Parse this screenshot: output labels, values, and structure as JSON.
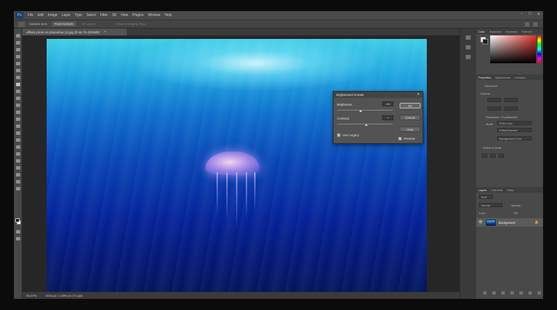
{
  "app": {
    "logo": "Ps"
  },
  "menu": [
    "File",
    "Edit",
    "Image",
    "Layer",
    "Type",
    "Select",
    "Filter",
    "3D",
    "View",
    "Plugins",
    "Window",
    "Help"
  ],
  "window_controls": [
    "–",
    "□",
    "✕"
  ],
  "options_bar": {
    "sample_size_label": "Sample Size:",
    "sample_size_value": "Point Sample",
    "sample_label": "All Layers",
    "ring_label": "Show Sampling Ring"
  },
  "document_tab": {
    "title": "affinity photo vs photoshop (1).jpg @ 66.7% (RGB/8)",
    "close": "✕"
  },
  "status": {
    "zoom": "66.67%",
    "doc_info": "2016 px x 1396 px (72 ppi)"
  },
  "dialog": {
    "title": "Brightness/Contrast",
    "close": "✕",
    "brightness_label": "Brightness:",
    "brightness_value": "-34",
    "contrast_label": "Contrast:",
    "contrast_value": "7",
    "use_legacy_label": "Use Legacy",
    "use_legacy_checked": true,
    "preview_label": "Preview",
    "preview_checked": true,
    "ok_label": "OK",
    "cancel_label": "Cancel",
    "auto_label": "Auto",
    "brightness_level": 0.43,
    "contrast_level": 0.53
  },
  "panels": {
    "color_tabs": [
      "Color",
      "Swatches",
      "Gradients",
      "Patterns"
    ],
    "props_tabs": [
      "Properties",
      "Adjustments",
      "Libraries"
    ],
    "props_doc_label": "Document",
    "canvas_label": "Canvas",
    "resolution_label": "Resolution: 72 pixels/inch",
    "mode_label": "Mode",
    "mode_value": "RGB Color",
    "depth_value": "8 Bits/Channel",
    "fill_value": "Background Color",
    "rulers_label": "Rulers & Grids",
    "layers_tabs": [
      "Layers",
      "Channels",
      "Paths"
    ],
    "layer_kind": "Kind",
    "blend_mode": "Normal",
    "opacity_label": "Opacity:",
    "lock_label": "Lock:",
    "fill_label": "Fill:",
    "layer_name": "Background",
    "eye": "👁",
    "lock_icon": "🔒"
  }
}
